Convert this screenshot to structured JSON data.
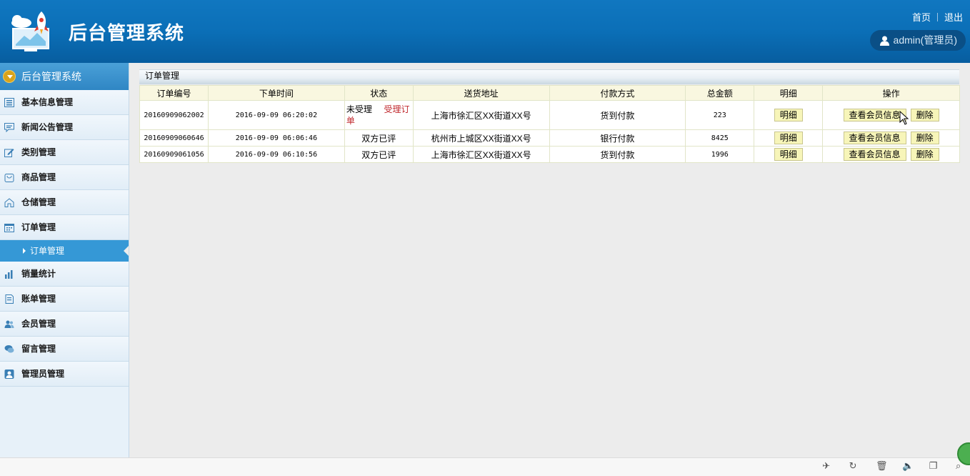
{
  "header": {
    "title": "后台管理系统",
    "links": {
      "home": "首页",
      "logout": "退出"
    },
    "user": "admin(管理员)"
  },
  "sidebar": {
    "head": "后台管理系统",
    "items": [
      {
        "label": "基本信息管理",
        "icon": "list-icon"
      },
      {
        "label": "新闻公告管理",
        "icon": "message-icon"
      },
      {
        "label": "类别管理",
        "icon": "edit-icon"
      },
      {
        "label": "商品管理",
        "icon": "bag-icon"
      },
      {
        "label": "仓储管理",
        "icon": "home-icon"
      },
      {
        "label": "订单管理",
        "icon": "calendar-icon"
      }
    ],
    "active_sub": "订单管理",
    "items_after": [
      {
        "label": "销量统计",
        "icon": "bar-chart-icon"
      },
      {
        "label": "账单管理",
        "icon": "document-icon"
      },
      {
        "label": "会员管理",
        "icon": "users-icon"
      },
      {
        "label": "留言管理",
        "icon": "chat-icon"
      },
      {
        "label": "管理员管理",
        "icon": "admin-icon"
      }
    ]
  },
  "main": {
    "panel_title": "订单管理",
    "columns": [
      "订单编号",
      "下单时间",
      "状态",
      "送货地址",
      "付款方式",
      "总金额",
      "明细",
      "操作"
    ],
    "rows": [
      {
        "id": "20160909062002",
        "time": "2016-09-09 06:20:02",
        "status": "未受理",
        "status_action": "受理订单",
        "address": "上海市徐汇区XX街道XX号",
        "payment": "货到付款",
        "total": "223"
      },
      {
        "id": "20160909060646",
        "time": "2016-09-09 06:06:46",
        "status": "双方已评",
        "address": "杭州市上城区XX街道XX号",
        "payment": "银行付款",
        "total": "8425"
      },
      {
        "id": "20160909061056",
        "time": "2016-09-09 06:10:56",
        "status": "双方已评",
        "address": "上海市徐汇区XX街道XX号",
        "payment": "货到付款",
        "total": "1996"
      }
    ],
    "btn_detail": "明细",
    "btn_member": "查看会员信息",
    "btn_delete": "删除"
  },
  "colors": {
    "header": "#0b6fb7",
    "sidebar_active": "#3598d6",
    "button_bg": "#f7f5b9",
    "accent_red": "#c0282d"
  }
}
